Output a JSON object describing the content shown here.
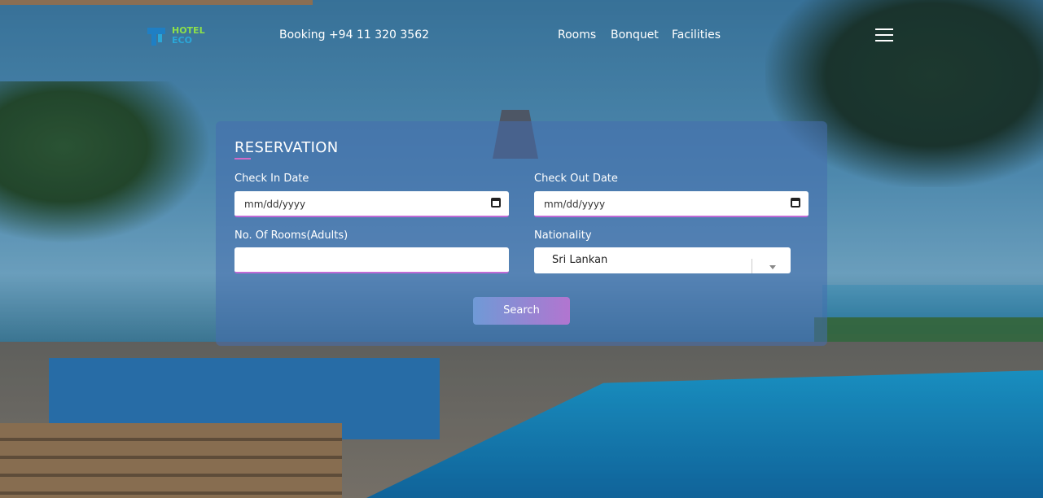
{
  "nav": {
    "logo_text_line1": "HOTEL",
    "logo_text_line2": "ECO",
    "booking": "Booking +94 11 320 3562",
    "links": [
      "Rooms",
      "Bonquet",
      "Facilities"
    ]
  },
  "reservation": {
    "title": "RESERVATION",
    "check_in_label": "Check In Date",
    "check_in_value": "mm/dd/yyyy",
    "check_out_label": "Check Out Date",
    "check_out_value": "mm/dd/yyyy",
    "rooms_label": "No. Of Rooms(Adults)",
    "rooms_value": "",
    "nationality_label": "Nationality",
    "nationality_value": "Sri Lankan",
    "search_label": "Search"
  },
  "colors": {
    "accent_gradient_start": "#6f9ad6",
    "accent_gradient_end": "#b275d0",
    "logo_green": "#8de04a",
    "logo_blue": "#1f7fc4"
  },
  "icons": [
    "hotel-logo-icon",
    "calendar-icon",
    "menu-icon",
    "chevron-down-icon"
  ]
}
